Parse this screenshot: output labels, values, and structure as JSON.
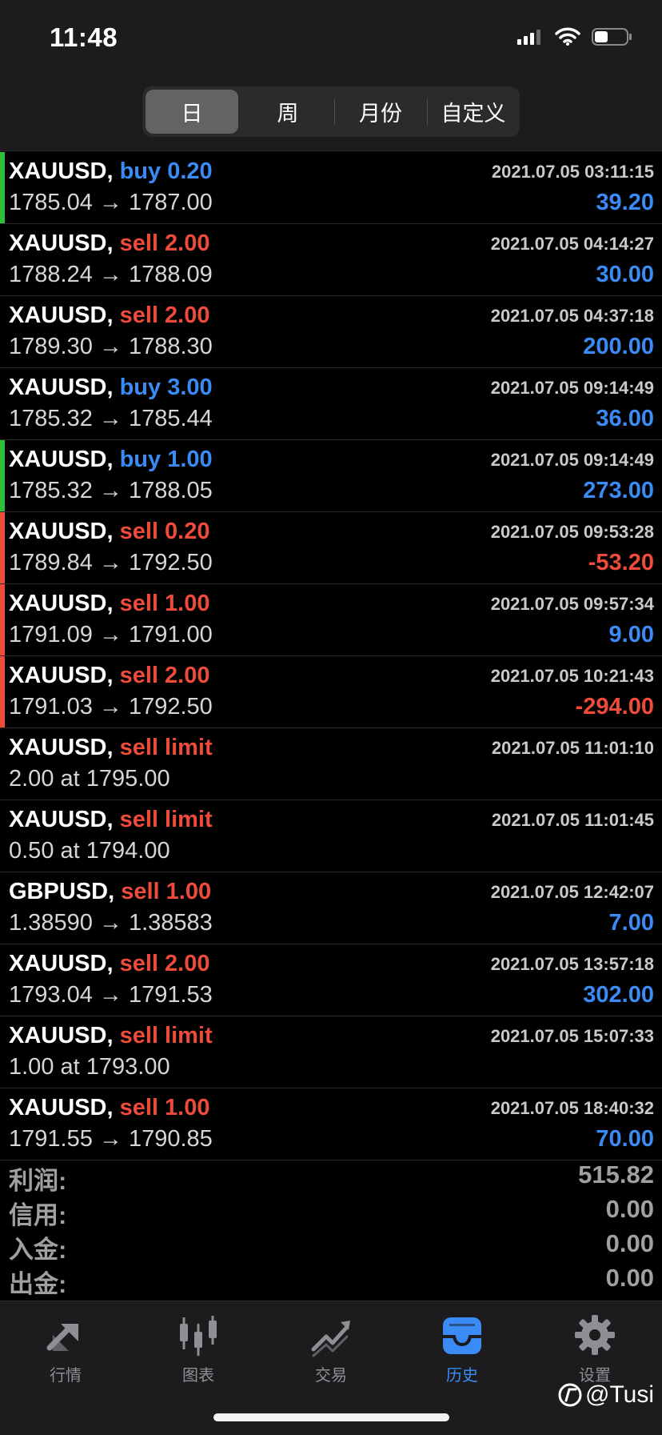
{
  "status": {
    "time": "11:48"
  },
  "segments": [
    "日",
    "周",
    "月份",
    "自定义"
  ],
  "trades": [
    {
      "symbol": "XAUUSD,",
      "action": "buy 0.20",
      "action_color": "blue",
      "time": "2021.07.05 03:11:15",
      "prices": "1785.04 → 1787.00",
      "profit": "39.20",
      "profit_color": "blue",
      "marker": "green"
    },
    {
      "symbol": "XAUUSD,",
      "action": "sell 2.00",
      "action_color": "red",
      "time": "2021.07.05 04:14:27",
      "prices": "1788.24 → 1788.09",
      "profit": "30.00",
      "profit_color": "blue",
      "marker": ""
    },
    {
      "symbol": "XAUUSD,",
      "action": "sell 2.00",
      "action_color": "red",
      "time": "2021.07.05 04:37:18",
      "prices": "1789.30 → 1788.30",
      "profit": "200.00",
      "profit_color": "blue",
      "marker": ""
    },
    {
      "symbol": "XAUUSD,",
      "action": "buy 3.00",
      "action_color": "blue",
      "time": "2021.07.05 09:14:49",
      "prices": "1785.32 → 1785.44",
      "profit": "36.00",
      "profit_color": "blue",
      "marker": ""
    },
    {
      "symbol": "XAUUSD,",
      "action": "buy 1.00",
      "action_color": "blue",
      "time": "2021.07.05 09:14:49",
      "prices": "1785.32 → 1788.05",
      "profit": "273.00",
      "profit_color": "blue",
      "marker": "green"
    },
    {
      "symbol": "XAUUSD,",
      "action": "sell 0.20",
      "action_color": "red",
      "time": "2021.07.05 09:53:28",
      "prices": "1789.84 → 1792.50",
      "profit": "-53.20",
      "profit_color": "red",
      "marker": "red"
    },
    {
      "symbol": "XAUUSD,",
      "action": "sell 1.00",
      "action_color": "red",
      "time": "2021.07.05 09:57:34",
      "prices": "1791.09 → 1791.00",
      "profit": "9.00",
      "profit_color": "blue",
      "marker": "red"
    },
    {
      "symbol": "XAUUSD,",
      "action": "sell 2.00",
      "action_color": "red",
      "time": "2021.07.05 10:21:43",
      "prices": "1791.03 → 1792.50",
      "profit": "-294.00",
      "profit_color": "red",
      "marker": "red"
    },
    {
      "symbol": "XAUUSD,",
      "action": "sell limit",
      "action_color": "red",
      "time": "2021.07.05 11:01:10",
      "prices": "2.00 at 1795.00",
      "profit": "",
      "profit_color": "blue",
      "marker": ""
    },
    {
      "symbol": "XAUUSD,",
      "action": "sell limit",
      "action_color": "red",
      "time": "2021.07.05 11:01:45",
      "prices": "0.50 at 1794.00",
      "profit": "",
      "profit_color": "blue",
      "marker": ""
    },
    {
      "symbol": "GBPUSD,",
      "action": "sell 1.00",
      "action_color": "red",
      "time": "2021.07.05 12:42:07",
      "prices": "1.38590 → 1.38583",
      "profit": "7.00",
      "profit_color": "blue",
      "marker": ""
    },
    {
      "symbol": "XAUUSD,",
      "action": "sell 2.00",
      "action_color": "red",
      "time": "2021.07.05 13:57:18",
      "prices": "1793.04 → 1791.53",
      "profit": "302.00",
      "profit_color": "blue",
      "marker": ""
    },
    {
      "symbol": "XAUUSD,",
      "action": "sell limit",
      "action_color": "red",
      "time": "2021.07.05 15:07:33",
      "prices": "1.00 at 1793.00",
      "profit": "",
      "profit_color": "blue",
      "marker": ""
    },
    {
      "symbol": "XAUUSD,",
      "action": "sell 1.00",
      "action_color": "red",
      "time": "2021.07.05 18:40:32",
      "prices": "1791.55 → 1790.85",
      "profit": "70.00",
      "profit_color": "blue",
      "marker": ""
    }
  ],
  "summary": [
    {
      "label": "利润:",
      "value": "515.82"
    },
    {
      "label": "信用:",
      "value": "0.00"
    },
    {
      "label": "入金:",
      "value": "0.00"
    },
    {
      "label": "出金:",
      "value": "0.00"
    }
  ],
  "tabs": [
    {
      "label": "行情",
      "icon": "quotes-arrows-icon",
      "active": false
    },
    {
      "label": "图表",
      "icon": "candlestick-chart-icon",
      "active": false
    },
    {
      "label": "交易",
      "icon": "trade-chart-icon",
      "active": false
    },
    {
      "label": "历史",
      "icon": "history-inbox-icon",
      "active": true
    },
    {
      "label": "设置",
      "icon": "gear-icon",
      "active": false
    }
  ],
  "watermark": "@Tusi",
  "colors": {
    "blue": "#3a8bf5",
    "red": "#ee4b3b",
    "green": "#2fbf3c"
  }
}
